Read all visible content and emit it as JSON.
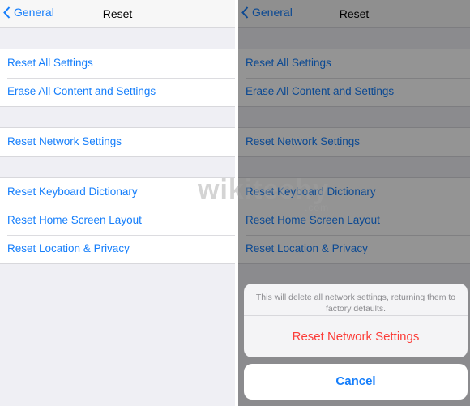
{
  "nav": {
    "back_label": "General",
    "title": "Reset"
  },
  "groups": [
    [
      "Reset All Settings",
      "Erase All Content and Settings"
    ],
    [
      "Reset Network Settings"
    ],
    [
      "Reset Keyboard Dictionary",
      "Reset Home Screen Layout",
      "Reset Location & Privacy"
    ]
  ],
  "action_sheet": {
    "message": "This will delete all network settings, returning them to factory defaults.",
    "destructive_label": "Reset Network Settings",
    "cancel_label": "Cancel"
  },
  "watermark": {
    "text": "wikitechy",
    "suffix": ".com"
  },
  "colors": {
    "accent": "#157efb",
    "destructive": "#fc3d39",
    "background": "#efeff4"
  }
}
